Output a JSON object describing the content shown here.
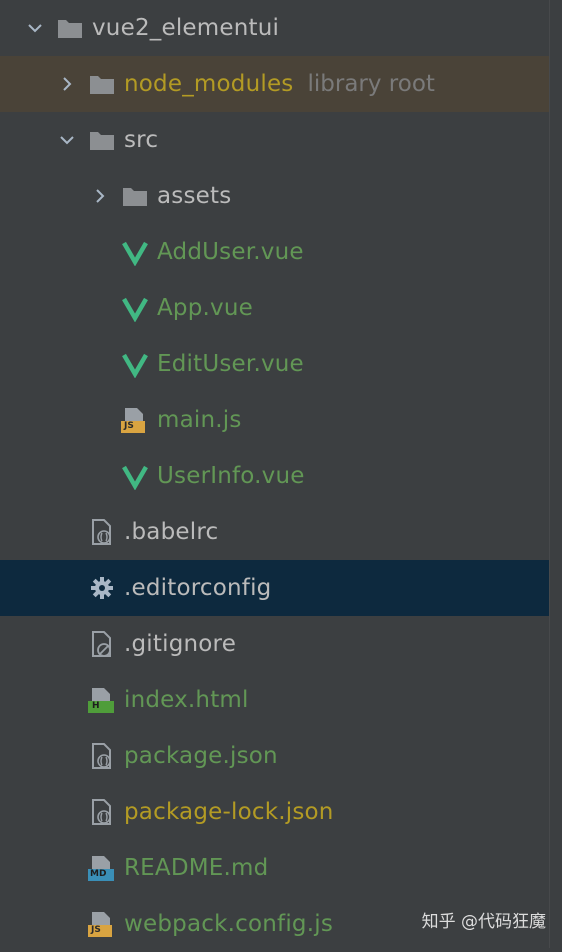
{
  "tree": {
    "root": {
      "label": "vue2_elementui",
      "icon": "folder-icon",
      "expanded": true
    },
    "node_modules": {
      "label": "node_modules",
      "hint": "library root",
      "icon": "folder-icon",
      "expanded": false
    },
    "src": {
      "label": "src",
      "icon": "folder-icon",
      "expanded": true
    },
    "assets": {
      "label": "assets",
      "icon": "folder-icon",
      "expanded": false
    },
    "adduser": {
      "label": "AddUser.vue",
      "icon": "vue-icon"
    },
    "app": {
      "label": "App.vue",
      "icon": "vue-icon"
    },
    "edituser": {
      "label": "EditUser.vue",
      "icon": "vue-icon"
    },
    "mainjs": {
      "label": "main.js",
      "icon": "js-file-icon"
    },
    "userinfo": {
      "label": "UserInfo.vue",
      "icon": "vue-icon"
    },
    "babelrc": {
      "label": ".babelrc",
      "icon": "config-file-icon"
    },
    "editorconfig": {
      "label": ".editorconfig",
      "icon": "gear-icon"
    },
    "gitignore": {
      "label": ".gitignore",
      "icon": "ignore-file-icon"
    },
    "indexhtml": {
      "label": "index.html",
      "icon": "html-file-icon"
    },
    "packagejson": {
      "label": "package.json",
      "icon": "config-file-icon"
    },
    "packagelock": {
      "label": "package-lock.json",
      "icon": "config-file-icon"
    },
    "readme": {
      "label": "README.md",
      "icon": "markdown-file-icon"
    },
    "webpack": {
      "label": "webpack.config.js",
      "icon": "js-file-icon"
    }
  },
  "badges": {
    "js": "JS",
    "html": "H",
    "md": "MD"
  },
  "watermark": "知乎 @代码狂魔",
  "colors": {
    "background": "#3c3f41",
    "selected_row": "#0d293e",
    "excluded_row": "#4a4338",
    "text_default": "#bbbbbb",
    "text_green": "#629755",
    "text_yellow": "#b39b24",
    "hint": "#7a7a7a",
    "vue_green": "#41b883",
    "js_badge": "#d9a441",
    "html_badge": "#4f9d3a",
    "md_badge": "#3a8fb7"
  }
}
